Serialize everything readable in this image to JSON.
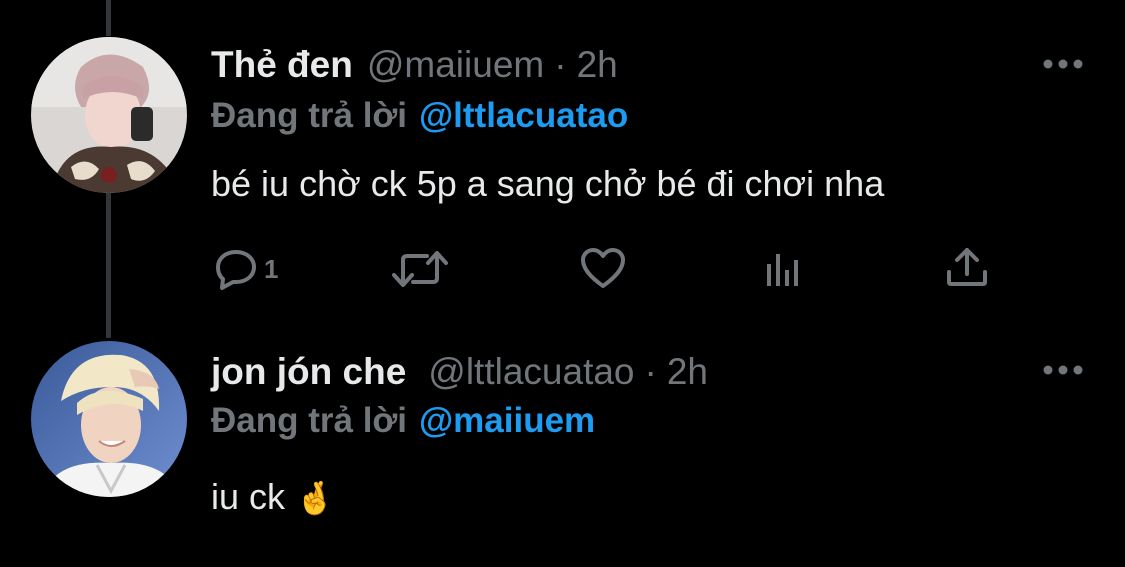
{
  "tweets": [
    {
      "display_name": "Thẻ đen",
      "handle": "@maiiuem",
      "separator": "·",
      "time": "2h",
      "reply_prefix": "Đang trả lời",
      "reply_to": "@lttlacuatao",
      "text": "bé iu chờ ck 5p a sang chở bé đi chơi nha",
      "actions": {
        "reply_count": "1"
      }
    },
    {
      "display_name": "jon jón che",
      "handle": "@lttlacuatao",
      "separator": "·",
      "time": "2h",
      "reply_prefix": "Đang trả lời",
      "reply_to": "@maiiuem",
      "text": "iu ck",
      "emoji": "🤞"
    }
  ],
  "colors": {
    "background": "#000000",
    "primary_text": "#e7e9ea",
    "secondary_text": "#71767b",
    "accent": "#1d9bf0",
    "thread_line": "#333639"
  }
}
